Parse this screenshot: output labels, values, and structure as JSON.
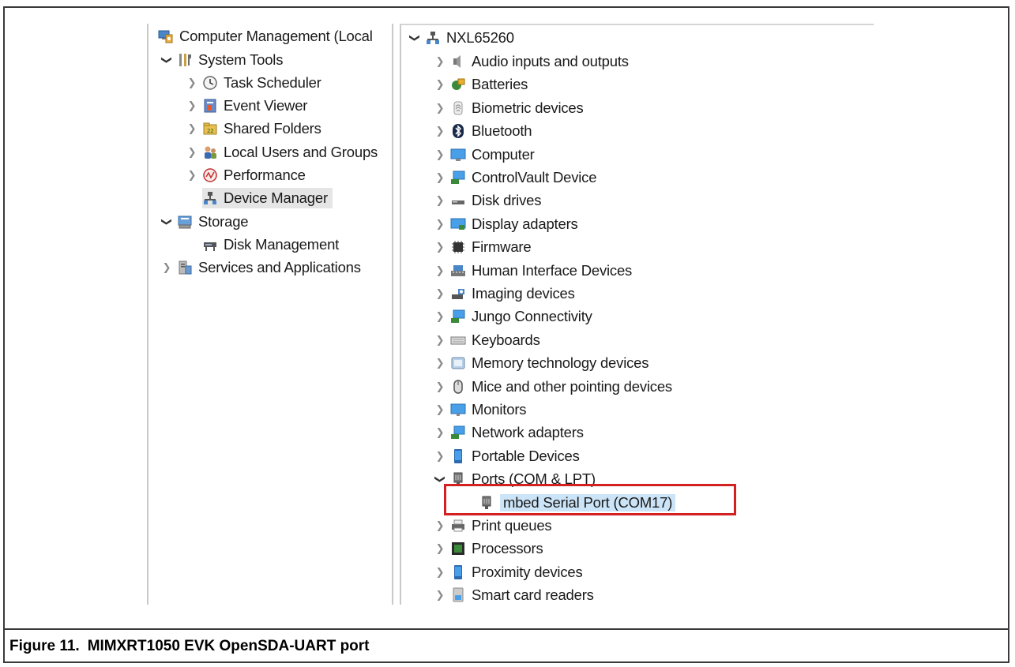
{
  "left_tree": {
    "root_label": "Computer Management (Local",
    "items": [
      {
        "label": "System Tools",
        "expander": "open",
        "icon": "tools-icon"
      },
      {
        "label": "Task Scheduler",
        "expander": "closed",
        "icon": "clock-icon"
      },
      {
        "label": "Event Viewer",
        "expander": "closed",
        "icon": "event-viewer-icon"
      },
      {
        "label": "Shared Folders",
        "expander": "closed",
        "icon": "shared-folder-icon"
      },
      {
        "label": "Local Users and Groups",
        "expander": "closed",
        "icon": "users-icon"
      },
      {
        "label": "Performance",
        "expander": "closed",
        "icon": "performance-icon"
      },
      {
        "label": "Device Manager",
        "expander": "none",
        "icon": "device-manager-icon",
        "selected": true
      },
      {
        "label": "Storage",
        "expander": "open",
        "icon": "storage-icon"
      },
      {
        "label": "Disk Management",
        "expander": "none",
        "icon": "disk-management-icon"
      },
      {
        "label": "Services and Applications",
        "expander": "closed",
        "icon": "services-icon"
      }
    ]
  },
  "device_tree": {
    "root_label": "NXL65260",
    "categories": [
      {
        "label": "Audio inputs and outputs",
        "icon": "speaker-icon"
      },
      {
        "label": "Batteries",
        "icon": "battery-icon"
      },
      {
        "label": "Biometric devices",
        "icon": "fingerprint-icon"
      },
      {
        "label": "Bluetooth",
        "icon": "bluetooth-icon"
      },
      {
        "label": "Computer",
        "icon": "computer-icon"
      },
      {
        "label": "ControlVault Device",
        "icon": "network-device-icon"
      },
      {
        "label": "Disk drives",
        "icon": "disk-drive-icon"
      },
      {
        "label": "Display adapters",
        "icon": "display-adapter-icon"
      },
      {
        "label": "Firmware",
        "icon": "chip-icon"
      },
      {
        "label": "Human Interface Devices",
        "icon": "hid-icon"
      },
      {
        "label": "Imaging devices",
        "icon": "camera-icon"
      },
      {
        "label": "Jungo Connectivity",
        "icon": "network-device-icon"
      },
      {
        "label": "Keyboards",
        "icon": "keyboard-icon"
      },
      {
        "label": "Memory technology devices",
        "icon": "memory-card-icon"
      },
      {
        "label": "Mice and other pointing devices",
        "icon": "mouse-icon"
      },
      {
        "label": "Monitors",
        "icon": "monitor-icon"
      },
      {
        "label": "Network adapters",
        "icon": "network-adapter-icon"
      },
      {
        "label": "Portable Devices",
        "icon": "portable-device-icon"
      },
      {
        "label": "Ports (COM & LPT)",
        "icon": "port-icon",
        "expanded": true
      },
      {
        "label": "mbed Serial Port (COM17)",
        "icon": "port-icon",
        "child": true,
        "highlighted": true
      },
      {
        "label": "Print queues",
        "icon": "printer-icon"
      },
      {
        "label": "Processors",
        "icon": "processor-icon"
      },
      {
        "label": "Proximity devices",
        "icon": "portable-device-icon"
      },
      {
        "label": "Smart card readers",
        "icon": "smart-card-icon"
      }
    ]
  },
  "colors": {
    "highlight_box": "#d32020",
    "selection_blue": "#cce4f7",
    "selection_grey": "#e5e5e5"
  },
  "caption": {
    "figure": "Figure 11.",
    "text": "MIMXRT1050 EVK OpenSDA-UART port"
  }
}
